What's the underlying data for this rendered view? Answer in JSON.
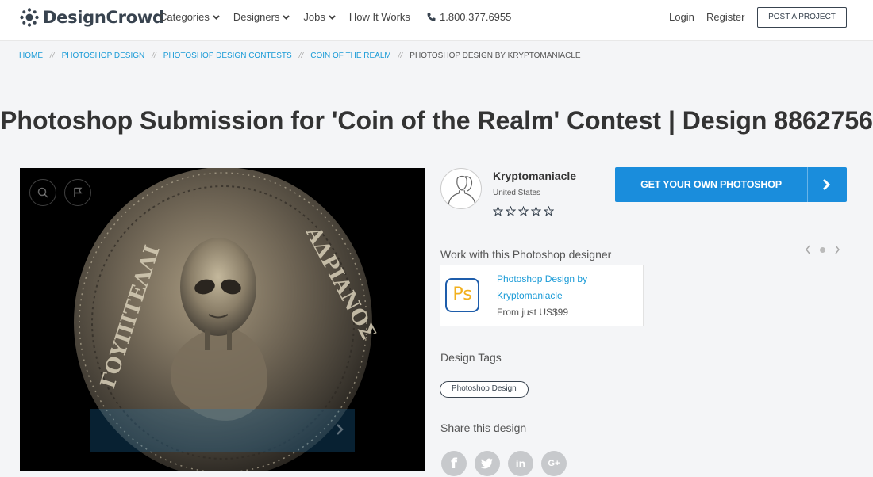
{
  "header": {
    "brand": "DesignCrowd",
    "nav": [
      {
        "label": "Categories",
        "dropdown": true
      },
      {
        "label": "Designers",
        "dropdown": true
      },
      {
        "label": "Jobs",
        "dropdown": true
      },
      {
        "label": "How It Works",
        "dropdown": false
      }
    ],
    "phone": "1.800.377.6955",
    "login": "Login",
    "register": "Register",
    "post_project": "POST A PROJECT"
  },
  "breadcrumb": {
    "items": [
      "HOME",
      "PHOTOSHOP DESIGN",
      "PHOTOSHOP DESIGN CONTESTS",
      "COIN OF THE REALM"
    ],
    "separator": "//",
    "current": "PHOTOSHOP DESIGN BY KRYPTOMANIACLE"
  },
  "page_title": "Photoshop Submission for 'Coin of the Realm' Contest | Design 8862756",
  "designer": {
    "name": "Kryptomaniacle",
    "location": "United States",
    "rating_stars": 5,
    "rating_filled": 0
  },
  "cta": {
    "label": "GET YOUR OWN PHOTOSHOP"
  },
  "work_with": {
    "heading": "Work with this Photoshop designer",
    "offer_line1": "Photoshop Design by",
    "offer_line2": "Kryptomaniacle",
    "offer_price": "From just US$99",
    "app_icon_text": "Ps"
  },
  "tags": {
    "heading": "Design Tags",
    "items": [
      "Photoshop Design"
    ]
  },
  "share": {
    "heading": "Share this design",
    "networks": [
      "facebook",
      "twitter",
      "linkedin",
      "google-plus"
    ],
    "glyphs": [
      "f",
      "",
      "in",
      "G+"
    ]
  },
  "colors": {
    "accent": "#1a8ddc",
    "link": "#1a9bd7",
    "brand_dark": "#38434f"
  }
}
